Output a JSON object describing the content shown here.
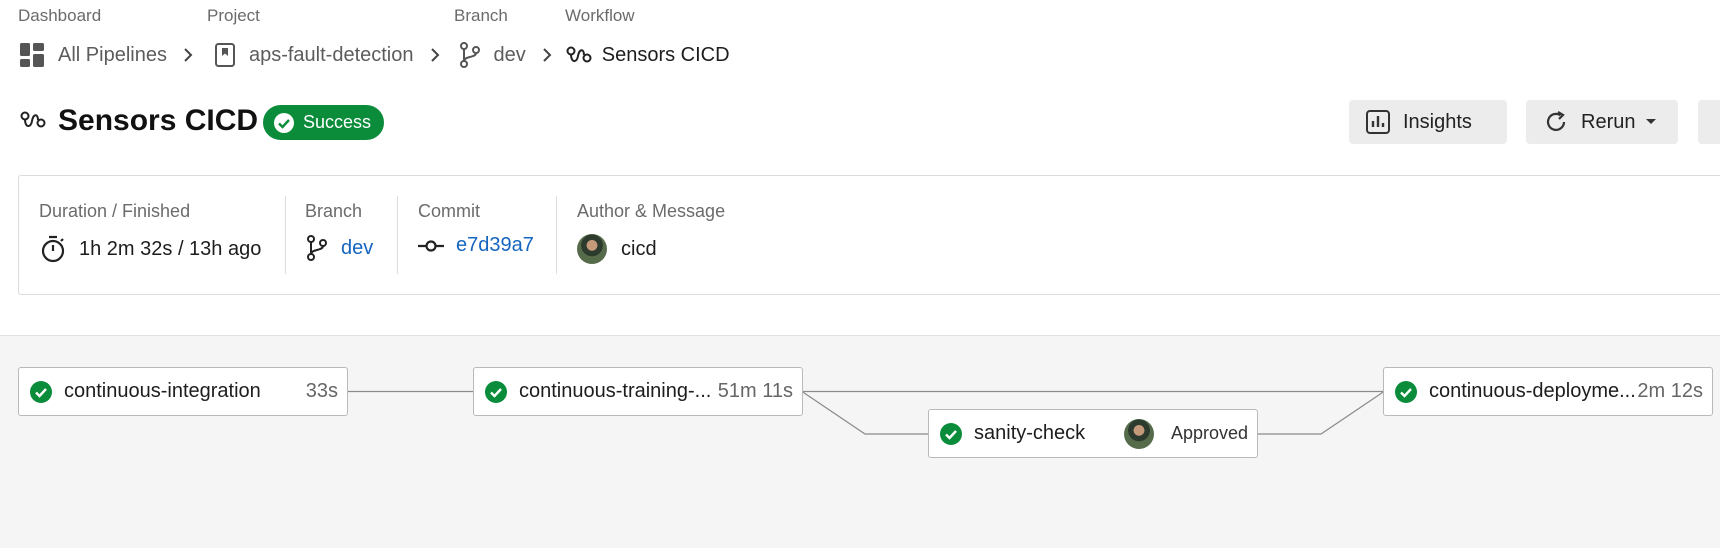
{
  "breadcrumb": {
    "dashboard_label": "Dashboard",
    "dashboard_value": "All Pipelines",
    "project_label": "Project",
    "project_value": "aps-fault-detection",
    "branch_label": "Branch",
    "branch_value": "dev",
    "workflow_label": "Workflow",
    "workflow_value": "Sensors CICD"
  },
  "header": {
    "title": "Sensors CICD",
    "status": "Success",
    "insights_label": "Insights",
    "rerun_label": "Rerun"
  },
  "info": {
    "duration_label": "Duration / Finished",
    "duration_value": "1h 2m 32s / 13h ago",
    "branch_label": "Branch",
    "branch_value": "dev",
    "commit_label": "Commit",
    "commit_value": "e7d39a7",
    "author_label": "Author & Message",
    "author_value": "cicd"
  },
  "pipeline": {
    "jobs": [
      {
        "name": "continuous-integration",
        "duration": "33s",
        "status": "success"
      },
      {
        "name": "continuous-training-...",
        "duration": "51m 11s",
        "status": "success"
      },
      {
        "name": "sanity-check",
        "duration": "Approved",
        "status": "success"
      },
      {
        "name": "continuous-deployme...",
        "duration": "2m 12s",
        "status": "success"
      }
    ]
  },
  "colors": {
    "success": "#0a8c3a",
    "link": "#1565c0",
    "canvas": "#f5f5f5"
  }
}
